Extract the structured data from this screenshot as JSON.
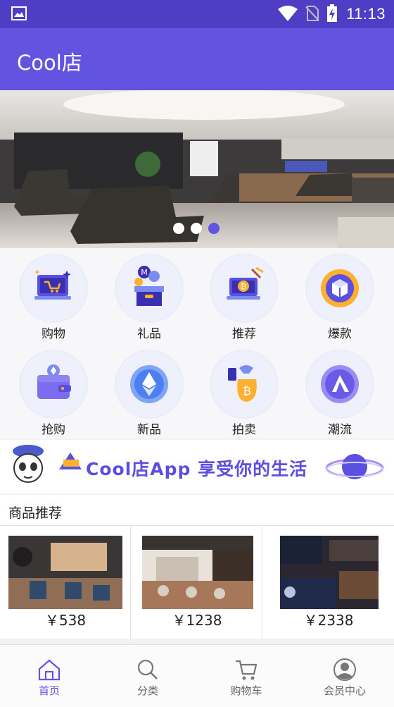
{
  "status_bar": {
    "time": "11:13"
  },
  "app_bar": {
    "title": "Cool店"
  },
  "banner": {
    "dots": 3,
    "active_dot": 3
  },
  "categories": [
    {
      "label": "购物",
      "icon": "laptop-cart-icon"
    },
    {
      "label": "礼品",
      "icon": "gift-box-icon"
    },
    {
      "label": "推荐",
      "icon": "laptop-bitcoin-icon"
    },
    {
      "label": "爆款",
      "icon": "cube-coin-icon"
    },
    {
      "label": "抢购",
      "icon": "wallet-icon"
    },
    {
      "label": "新品",
      "icon": "ethereum-icon"
    },
    {
      "label": "拍卖",
      "icon": "bitcoin-bag-icon"
    },
    {
      "label": "潮流",
      "icon": "arrow-coin-icon"
    }
  ],
  "promo": {
    "slogan": "Cool店App  享受你的生活"
  },
  "section": {
    "title": "商品推荐"
  },
  "products": [
    {
      "price": "￥538"
    },
    {
      "price": "￥1238"
    },
    {
      "price": "￥2338"
    }
  ],
  "bottom_nav": [
    {
      "label": "首页",
      "icon": "home-icon",
      "active": true
    },
    {
      "label": "分类",
      "icon": "search-icon",
      "active": false
    },
    {
      "label": "购物车",
      "icon": "cart-icon",
      "active": false
    },
    {
      "label": "会员中心",
      "icon": "user-icon",
      "active": false
    }
  ],
  "colors": {
    "primary": "#6253e1",
    "status_bar": "#4d3ec5"
  }
}
